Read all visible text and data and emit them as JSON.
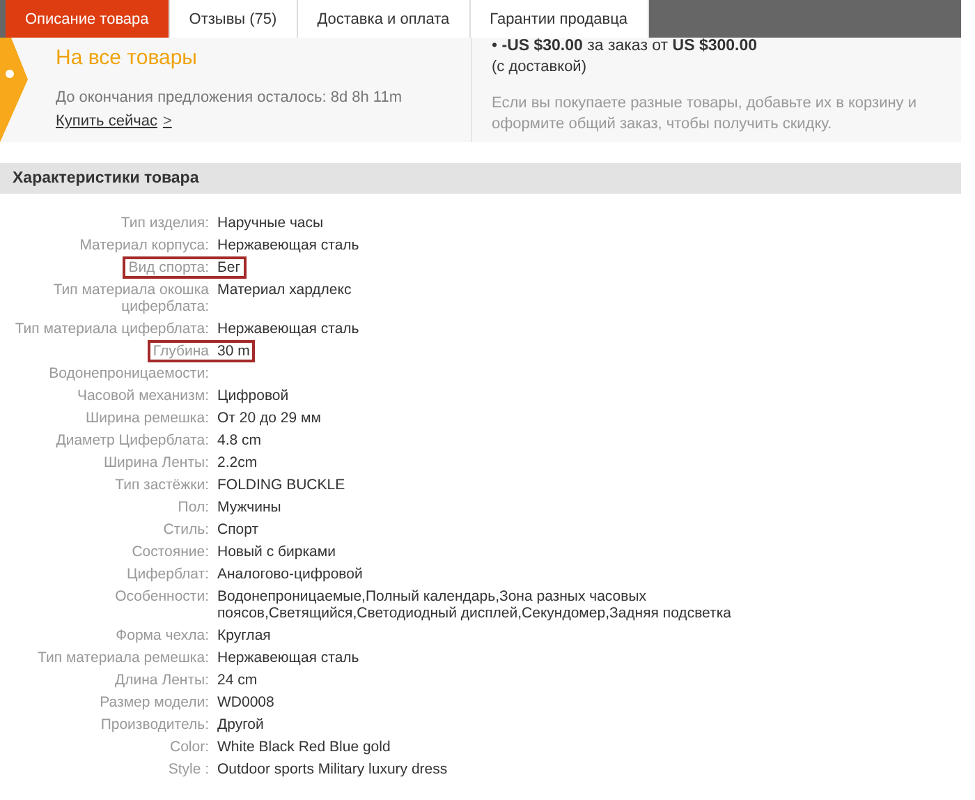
{
  "tabs": [
    {
      "label": "Описание товара",
      "selected": true
    },
    {
      "label": "Отзывы (75)",
      "selected": false
    },
    {
      "label": "Доставка и оплата",
      "selected": false
    },
    {
      "label": "Гарантии продавца",
      "selected": false
    }
  ],
  "promo": {
    "subtitle": "На все товары",
    "countdown": "До окончания предложения осталось: 8d 8h 11m",
    "buy_link": "Купить сейчас",
    "buy_caret": ">",
    "offer_bullet": "•",
    "offer": "**-US $30.00** за заказ от **US $300.00**",
    "offer_note": "(с доставкой)",
    "hint": "Если вы покупаете разные товары, добавьте их в корзину и оформите общий заказ, чтобы получить скидку."
  },
  "specs": {
    "title": "Характеристики товара",
    "rows": [
      {
        "label": "Тип изделия:",
        "value": "Наручные часы",
        "highlighted": false
      },
      {
        "label": "Материал корпуса:",
        "value": "Нержавеющая сталь",
        "highlighted": false
      },
      {
        "label": "Вид спорта:",
        "value": "Бег",
        "highlighted": true
      },
      {
        "label": "Тип материала окошка циферблата:",
        "value": "Материал хардлекс",
        "highlighted": false
      },
      {
        "label": "Тип материала циферблата:",
        "value": "Нержавеющая сталь",
        "highlighted": false
      },
      {
        "label": "Глубина",
        "value": "30 m",
        "highlighted": true
      },
      {
        "label": "Водонепроницаемости:",
        "value": "",
        "highlighted": false
      },
      {
        "label": "Часовой механизм:",
        "value": "Цифровой",
        "highlighted": false
      },
      {
        "label": "Ширина ремешка:",
        "value": "От 20 до 29 мм",
        "highlighted": false
      },
      {
        "label": "Диаметр Циферблата:",
        "value": "4.8 cm",
        "highlighted": false
      },
      {
        "label": "Ширина Ленты:",
        "value": "2.2cm",
        "highlighted": false
      },
      {
        "label": "Тип застёжки:",
        "value": "FOLDING BUCKLE",
        "highlighted": false
      },
      {
        "label": "Пол:",
        "value": "Мужчины",
        "highlighted": false
      },
      {
        "label": "Стиль:",
        "value": "Спорт",
        "highlighted": false
      },
      {
        "label": "Состояние:",
        "value": "Новый с бирками",
        "highlighted": false
      },
      {
        "label": "Циферблат:",
        "value": "Аналогово-цифровой",
        "highlighted": false
      },
      {
        "label": "Особенности:",
        "value": "Водонепроницаемые,Полный календарь,Зона разных часовых поясов,Светящийся,Светодиодный дисплей,Секундомер,Задняя подсветка",
        "highlighted": false
      },
      {
        "label": "Форма чехла:",
        "value": "Круглая",
        "highlighted": false
      },
      {
        "label": "Тип материала ремешка:",
        "value": "Нержавеющая сталь",
        "highlighted": false
      },
      {
        "label": "Длина Ленты:",
        "value": "24 cm",
        "highlighted": false
      },
      {
        "label": "Размер модели:",
        "value": "WD0008",
        "highlighted": false
      },
      {
        "label": "Производитель:",
        "value": "Другой",
        "highlighted": false
      },
      {
        "label": "Color:",
        "value": "White Black Red Blue gold",
        "highlighted": false
      },
      {
        "label": "Style :",
        "value": "Outdoor sports Military luxury dress",
        "highlighted": false
      }
    ]
  }
}
